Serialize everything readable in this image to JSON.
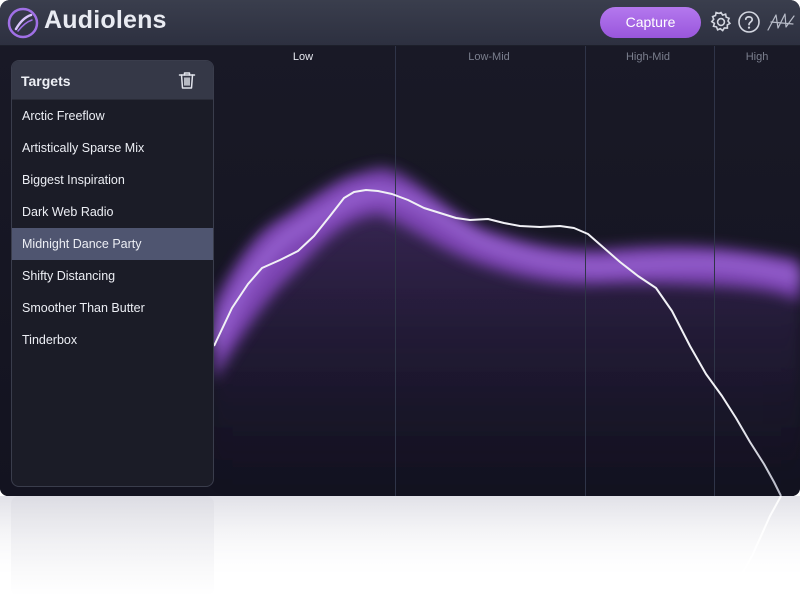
{
  "app": {
    "title": "Audiolens",
    "capture_label": "Capture",
    "icons": {
      "logo": "audiolens-logo",
      "settings": "gear-icon",
      "help": "help-icon",
      "brand": "izotope-signature-icon"
    }
  },
  "bands": [
    {
      "label": "Low",
      "active": true
    },
    {
      "label": "Low-Mid",
      "active": false
    },
    {
      "label": "High-Mid",
      "active": false
    },
    {
      "label": "High",
      "active": false
    }
  ],
  "targets": {
    "title": "Targets",
    "delete_icon": "trash-icon",
    "selected": "Midnight Dance Party",
    "items": [
      "Arctic Freeflow",
      "Artistically Sparse Mix",
      "Biggest Inspiration",
      "Dark Web Radio",
      "Midnight Dance Party",
      "Shifty Distancing",
      "Smoother Than Butter",
      "Tinderbox"
    ]
  },
  "colors": {
    "accent": "#a066e6",
    "target_band": "#8a4ec6",
    "curve": "#f1f1f6",
    "selected_row": "#4f5570"
  }
}
